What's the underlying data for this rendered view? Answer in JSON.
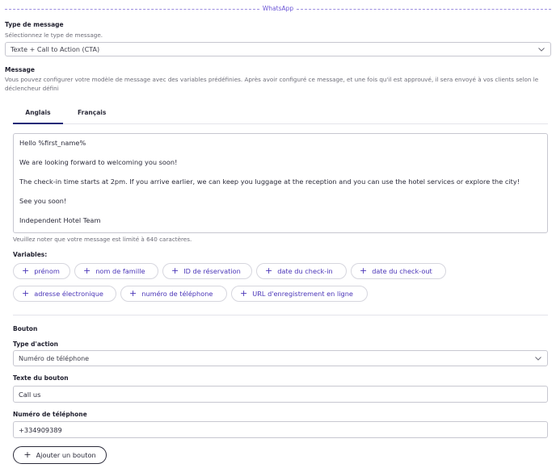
{
  "section_title": "WhatsApp",
  "message_type": {
    "label": "Type de message",
    "hint": "Sélectionnez le type de message.",
    "selected": "Texte + Call to Action (CTA)"
  },
  "message": {
    "label": "Message",
    "description": "Vous pouvez configurer votre modèle de message avec des variables prédéfinies. Après avoir configuré ce message, et une fois qu'il est approuvé, il sera envoyé à vos clients selon le déclencheur défini",
    "tabs": [
      {
        "label": "Anglais"
      },
      {
        "label": "Français"
      }
    ],
    "lines": [
      "Hello %first_name%",
      "We are looking forward to welcoming you soon!",
      "The check-in time starts at 2pm. If you arrive earlier, we can keep you luggage at the reception and you can use the hotel services or explore the city!",
      "See you soon!",
      "Independent Hotel Team"
    ],
    "limit_note": "Veuillez noter que votre message est limité à 640 caractères."
  },
  "variables": {
    "label": "Variables:",
    "items": [
      "prénom",
      "nom de famille",
      "ID de réservation",
      "date du check-in",
      "date du check-out",
      "adresse électronique",
      "numéro de téléphone",
      "URL d'enregistrement en ligne"
    ]
  },
  "button_section": {
    "title": "Bouton",
    "action_type_label": "Type d'action",
    "action_type_value": "Numéro de téléphone",
    "button_text_label": "Texte du bouton",
    "button_text_value": "Call us",
    "phone_label": "Numéro de téléphone",
    "phone_value": "+334909389",
    "add_button_label": "Ajouter un bouton"
  },
  "colors": {
    "accent": "#4a35b8",
    "tab_underline": "#1e2a78",
    "divider": "#9c8ee0"
  }
}
